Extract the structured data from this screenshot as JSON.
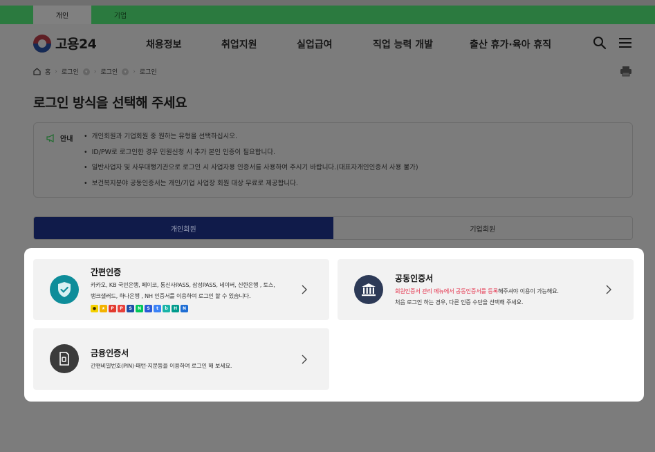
{
  "header": {
    "user_tabs": [
      {
        "label": "개인"
      },
      {
        "label": "기업"
      }
    ],
    "logo_text": "고용24",
    "menu": [
      {
        "label": "채용정보"
      },
      {
        "label": "취업지원"
      },
      {
        "label": "실업급여"
      },
      {
        "label": "직업 능력 개발"
      },
      {
        "label": "출산 휴가·육아 휴직"
      }
    ],
    "icons": {
      "search": "search-icon",
      "menu": "hamburger-menu-icon"
    }
  },
  "breadcrumb": {
    "home": "홈",
    "items": [
      {
        "label": "로그인"
      },
      {
        "label": "로그인"
      },
      {
        "label": "로그인"
      }
    ]
  },
  "page": {
    "title": "로그인 방식을 선택해 주세요"
  },
  "notice": {
    "label": "안내",
    "items": [
      "개인회원과 기업회원 중 원하는 유형을 선택하십시오.",
      "ID/PW로 로그인한 경우 민원신청 시 추가 본인 인증이 필요합니다.",
      "일반사업자 및 사무대행기관으로 로그인 시 사업자용 인증서를 사용하여 주시기 바랍니다.(대표자개인인증서 사용 불가)",
      "보건복지분야 공동인증서는 개인/기업 사업장 회원 대상 무료로 제공합니다."
    ]
  },
  "member_tabs": {
    "personal": "개인회원",
    "corporate": "기업회원",
    "selected": "personal"
  },
  "login_methods": {
    "simple": {
      "title": "간편인증",
      "desc_line1": "카카오, KB 국민은행, 페이코, 통신사PASS, 삼성PASS, 네이버, 신한은행 , 토스,",
      "desc_line2": "뱅크샐러드, 하나은행 , NH 인증서를 이용하여 로그인 할 수 있습니다.",
      "icon": "shield-check-icon"
    },
    "joint": {
      "title": "공동인증서",
      "desc_highlight": "회원인증서 관리 메뉴에서 공동인증서를 등록",
      "desc_rest": "해주셔야 이용이 가능해요.",
      "desc_line2": "처음 로그인 하는 경우, 다른 인증 수단을 선택해 주세요.",
      "icon": "bank-building-icon"
    },
    "financial": {
      "title": "금융인증서",
      "desc": "간편비밀번호(PIN)·패턴·지문등을 이용하여 로그인 해 보세요.",
      "icon": "certificate-document-icon"
    }
  },
  "colors": {
    "accent_navy": "#101b4a",
    "simple_icon_bg": "#0e8d9a",
    "joint_icon_bg": "#2d3a57",
    "financial_icon_bg": "#3b3b3b",
    "highlight_red": "#e4304a"
  }
}
